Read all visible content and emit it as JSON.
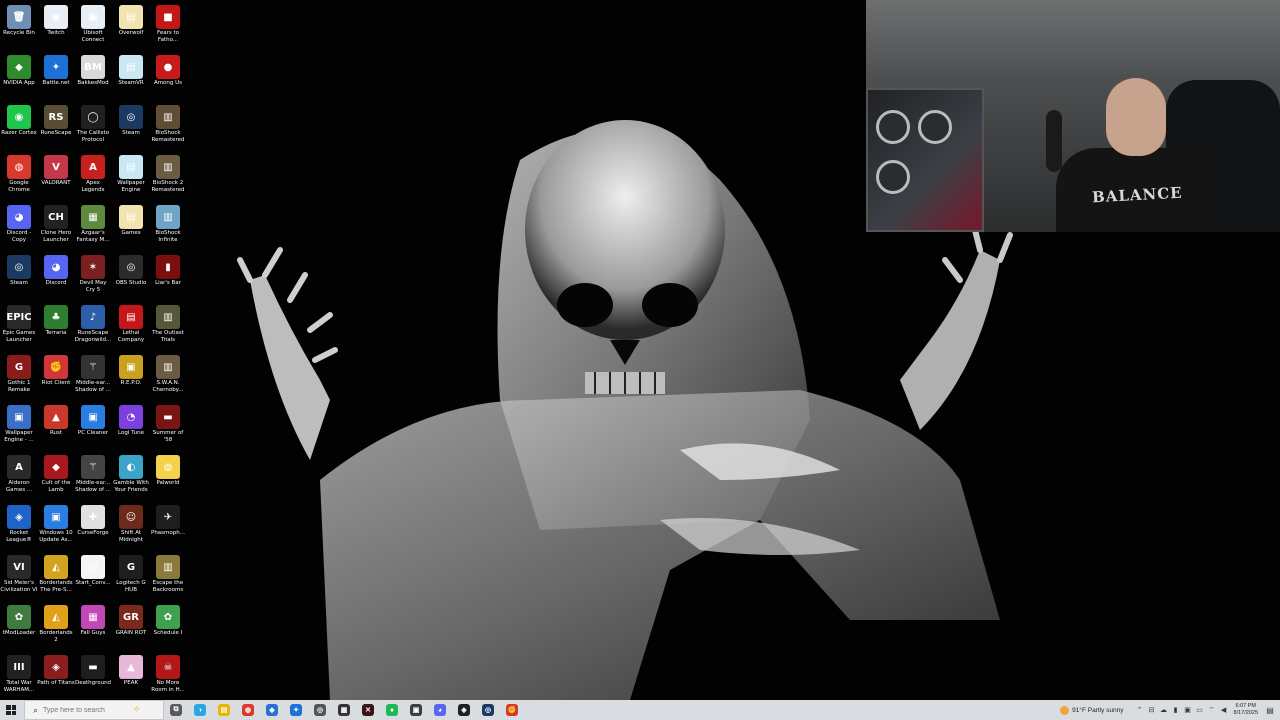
{
  "desktop": {
    "icons": [
      {
        "label": "Recycle Bin",
        "glyph": "🗑",
        "color": "#6f8fb5"
      },
      {
        "label": "Twitch",
        "glyph": "▣",
        "color": "#e8eef5"
      },
      {
        "label": "Ubisoft Connect",
        "glyph": "▣",
        "color": "#e8eef5"
      },
      {
        "label": "Overwolf",
        "glyph": "▤",
        "color": "#f1e4b0"
      },
      {
        "label": "Fears to Fatho...",
        "glyph": "■",
        "color": "#c41818"
      },
      {
        "label": "NVIDIA App",
        "glyph": "◆",
        "color": "#2e8b2e"
      },
      {
        "label": "Battle.net",
        "glyph": "✦",
        "color": "#1e6fd6"
      },
      {
        "label": "BakkesMod",
        "glyph": "BM",
        "color": "#d9d9d9"
      },
      {
        "label": "SteamVR",
        "glyph": "▤",
        "color": "#c9e8f4"
      },
      {
        "label": "Among Us",
        "glyph": "●",
        "color": "#c81b1b"
      },
      {
        "label": "Razer Cortex",
        "glyph": "◉",
        "color": "#1ec64c"
      },
      {
        "label": "RuneScape",
        "glyph": "RS",
        "color": "#5a4d35"
      },
      {
        "label": "The Callisto Protocol",
        "glyph": "◯",
        "color": "#202020"
      },
      {
        "label": "Steam",
        "glyph": "◎",
        "color": "#1b3a63"
      },
      {
        "label": "BioShock Remastered",
        "glyph": "▥",
        "color": "#5f4e35"
      },
      {
        "label": "Google Chrome",
        "glyph": "◍",
        "color": "#d8392c"
      },
      {
        "label": "VALORANT",
        "glyph": "V",
        "color": "#c53849"
      },
      {
        "label": "Apex Legends",
        "glyph": "A",
        "color": "#c8201d"
      },
      {
        "label": "Wallpaper Engine",
        "glyph": "▤",
        "color": "#c9e8f4"
      },
      {
        "label": "BioShock 2 Remastered",
        "glyph": "▥",
        "color": "#6b5b42"
      },
      {
        "label": "Discord - Copy",
        "glyph": "◕",
        "color": "#5865f2"
      },
      {
        "label": "Clone Hero Launcher",
        "glyph": "CH",
        "color": "#222"
      },
      {
        "label": "Azgaar's Fantasy M...",
        "glyph": "▦",
        "color": "#5d8a3c"
      },
      {
        "label": "Games",
        "glyph": "▤",
        "color": "#f1e4b0"
      },
      {
        "label": "BioShock Infinite",
        "glyph": "▥",
        "color": "#6fa4c7"
      },
      {
        "label": "Steam",
        "glyph": "◎",
        "color": "#1b3a63"
      },
      {
        "label": "Discord",
        "glyph": "◕",
        "color": "#5865f2"
      },
      {
        "label": "Devil May Cry 5",
        "glyph": "✶",
        "color": "#7a2020"
      },
      {
        "label": "OBS Studio",
        "glyph": "◎",
        "color": "#2b2b2b"
      },
      {
        "label": "Liar's Bar",
        "glyph": "▮",
        "color": "#7a0f0f"
      },
      {
        "label": "Epic Games Launcher",
        "glyph": "EPIC",
        "color": "#2a2a2a"
      },
      {
        "label": "Terraria",
        "glyph": "♣",
        "color": "#2f7d2f"
      },
      {
        "label": "RuneScape Dragonwild...",
        "glyph": "♪",
        "color": "#2b5fa8"
      },
      {
        "label": "Lethal Company",
        "glyph": "▤",
        "color": "#c41818"
      },
      {
        "label": "The Outlast Trials",
        "glyph": "▥",
        "color": "#55563a"
      },
      {
        "label": "Gothic 1 Remake",
        "glyph": "G",
        "color": "#8a1c1c"
      },
      {
        "label": "Riot Client",
        "glyph": "✊",
        "color": "#d13639"
      },
      {
        "label": "Middle-ear... Shadow of ...",
        "glyph": "⚚",
        "color": "#333"
      },
      {
        "label": "R.E.P.O.",
        "glyph": "▣",
        "color": "#caa11c"
      },
      {
        "label": "S.W.A.N. Chernoby...",
        "glyph": "▥",
        "color": "#6b5b42"
      },
      {
        "label": "Wallpaper Engine - ...",
        "glyph": "▣",
        "color": "#3a6fc8"
      },
      {
        "label": "Rust",
        "glyph": "▲",
        "color": "#c8392b"
      },
      {
        "label": "PC Cleaner",
        "glyph": "▣",
        "color": "#2a7de1"
      },
      {
        "label": "Logi Tune",
        "glyph": "◔",
        "color": "#7e3fe0"
      },
      {
        "label": "Summer of '58",
        "glyph": "▬",
        "color": "#7a1515"
      },
      {
        "label": "Alderon Games ...",
        "glyph": "A",
        "color": "#2a2a2a"
      },
      {
        "label": "Cult of the Lamb",
        "glyph": "◆",
        "color": "#a8181e"
      },
      {
        "label": "Middle-ear... Shadow of ...",
        "glyph": "⚚",
        "color": "#444"
      },
      {
        "label": "Gamble With Your Friends",
        "glyph": "◐",
        "color": "#3aa4c9"
      },
      {
        "label": "Palworld",
        "glyph": "◍",
        "color": "#f4d24a"
      },
      {
        "label": "Rocket League®",
        "glyph": "◈",
        "color": "#1f63c8"
      },
      {
        "label": "Windows 10 Update As...",
        "glyph": "▣",
        "color": "#2a7de1"
      },
      {
        "label": "CurseForge",
        "glyph": "✚",
        "color": "#e0e0e0"
      },
      {
        "label": "Shift At Midnight",
        "glyph": "☺",
        "color": "#6b2a1a"
      },
      {
        "label": "Phasmoph...",
        "glyph": "✈",
        "color": "#1e1e1e"
      },
      {
        "label": "Sid Meier's Civilization VI",
        "glyph": "VI",
        "color": "#2a2a2a"
      },
      {
        "label": "Borderlands The Pre-S...",
        "glyph": "◭",
        "color": "#d1a31f"
      },
      {
        "label": "Start_Conv...",
        "glyph": "▤",
        "color": "#f4f4f4"
      },
      {
        "label": "Logitech G HUB",
        "glyph": "G",
        "color": "#1e1e1e"
      },
      {
        "label": "Escape the Backrooms",
        "glyph": "▥",
        "color": "#8a7b3a"
      },
      {
        "label": "tModLoader",
        "glyph": "✿",
        "color": "#3f7a3f"
      },
      {
        "label": "Borderlands 2",
        "glyph": "◭",
        "color": "#e0a018"
      },
      {
        "label": "Fall Guys",
        "glyph": "▦",
        "color": "#c447b8"
      },
      {
        "label": "GRAIN ROT",
        "glyph": "GR",
        "color": "#7a2a1a"
      },
      {
        "label": "Schedule I",
        "glyph": "✿",
        "color": "#3fa04f"
      },
      {
        "label": "Total War WARHAM...",
        "glyph": "III",
        "color": "#222"
      },
      {
        "label": "Path of Titans",
        "glyph": "◈",
        "color": "#8a1e1e"
      },
      {
        "label": "Deathground",
        "glyph": "▬",
        "color": "#1e1e1e"
      },
      {
        "label": "PEAK",
        "glyph": "▲",
        "color": "#e7b8d8"
      },
      {
        "label": "No More Room in H...",
        "glyph": "☠",
        "color": "#b21818"
      }
    ]
  },
  "webcam": {
    "shirt_text": "BALANCE"
  },
  "taskbar": {
    "search_placeholder": "Type here to search",
    "apps": [
      {
        "name": "task-view",
        "glyph": "⧉",
        "color": "#5a5a5a"
      },
      {
        "name": "copilot",
        "glyph": "◑",
        "color": "#2aa7e0"
      },
      {
        "name": "file-explorer",
        "glyph": "▤",
        "color": "#e8b400"
      },
      {
        "name": "chrome",
        "glyph": "◍",
        "color": "#d8392c"
      },
      {
        "name": "twitch-app",
        "glyph": "◆",
        "color": "#2a6fd6"
      },
      {
        "name": "outlook",
        "glyph": "✦",
        "color": "#1e6fd6"
      },
      {
        "name": "obs",
        "glyph": "◎",
        "color": "#555"
      },
      {
        "name": "calculator",
        "glyph": "▦",
        "color": "#333"
      },
      {
        "name": "terminal",
        "glyph": "✕",
        "color": "#3a1515"
      },
      {
        "name": "spotify",
        "glyph": "●",
        "color": "#1db954"
      },
      {
        "name": "notepad",
        "glyph": "▣",
        "color": "#3d3d3d"
      },
      {
        "name": "discord",
        "glyph": "◕",
        "color": "#5865f2"
      },
      {
        "name": "epic",
        "glyph": "◈",
        "color": "#202020"
      },
      {
        "name": "steam",
        "glyph": "◎",
        "color": "#1b3a63"
      },
      {
        "name": "riot",
        "glyph": "✊",
        "color": "#d13639"
      }
    ],
    "weather_text": "91°F  Partly sunny",
    "clock_time": "6:07 PM",
    "clock_date": "8/17/2025"
  }
}
